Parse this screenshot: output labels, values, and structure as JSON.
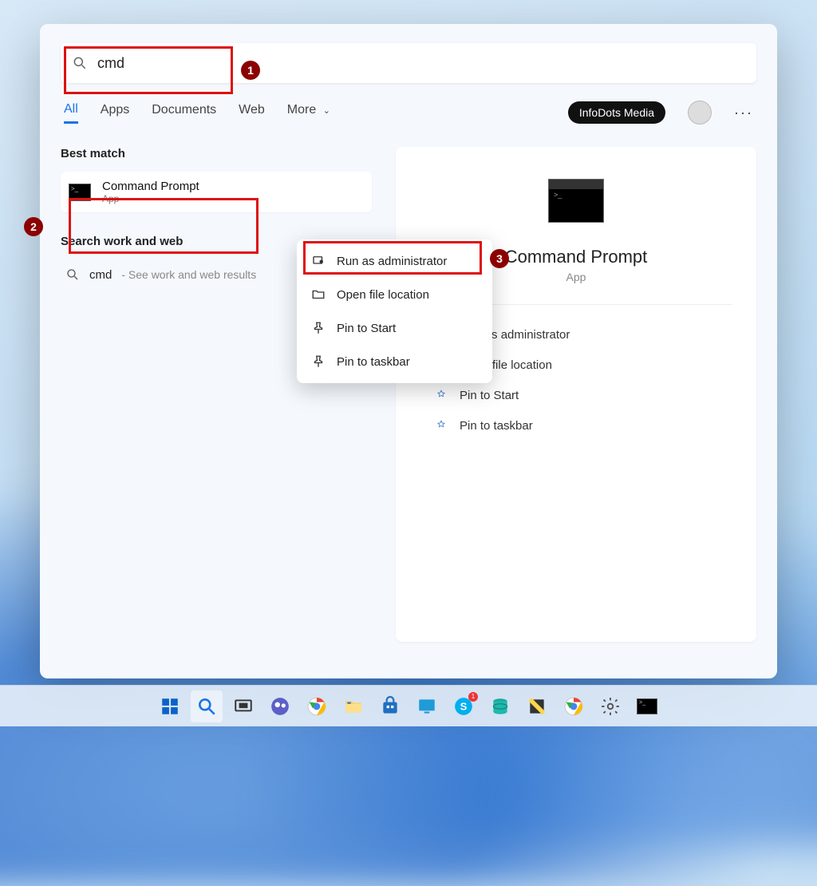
{
  "search": {
    "value": "cmd"
  },
  "tabs": {
    "all": "All",
    "apps": "Apps",
    "documents": "Documents",
    "web": "Web",
    "more": "More"
  },
  "header": {
    "user_chip": "InfoDots Media"
  },
  "results": {
    "best_match_label": "Best match",
    "top": {
      "title": "Command Prompt",
      "subtitle": "App"
    },
    "search_web_label": "Search work and web",
    "web_item_term": "cmd",
    "web_item_hint": "- See work and web results"
  },
  "context_menu": {
    "run_admin": "Run as administrator",
    "open_loc": "Open file location",
    "pin_start": "Pin to Start",
    "pin_taskbar": "Pin to taskbar"
  },
  "detail": {
    "title": "Command Prompt",
    "subtitle": "App",
    "actions": {
      "run_admin": "Run as administrator",
      "open_loc": "Open file location",
      "pin_start": "Pin to Start",
      "pin_taskbar": "Pin to taskbar"
    }
  },
  "annotations": {
    "n1": "1",
    "n2": "2",
    "n3": "3"
  },
  "taskbar": {
    "start": "start-icon",
    "search": "search-icon",
    "taskview": "task-view-icon",
    "teams": "teams-icon",
    "chrome": "chrome-icon",
    "explorer": "file-explorer-icon",
    "store": "store-icon",
    "monitor": "monitor-icon",
    "skype": "skype-icon",
    "skype_badge": "1",
    "db": "database-icon",
    "notes": "notes-icon",
    "chrome2": "chrome-icon",
    "settings": "settings-icon",
    "cmd": "cmd-icon"
  }
}
